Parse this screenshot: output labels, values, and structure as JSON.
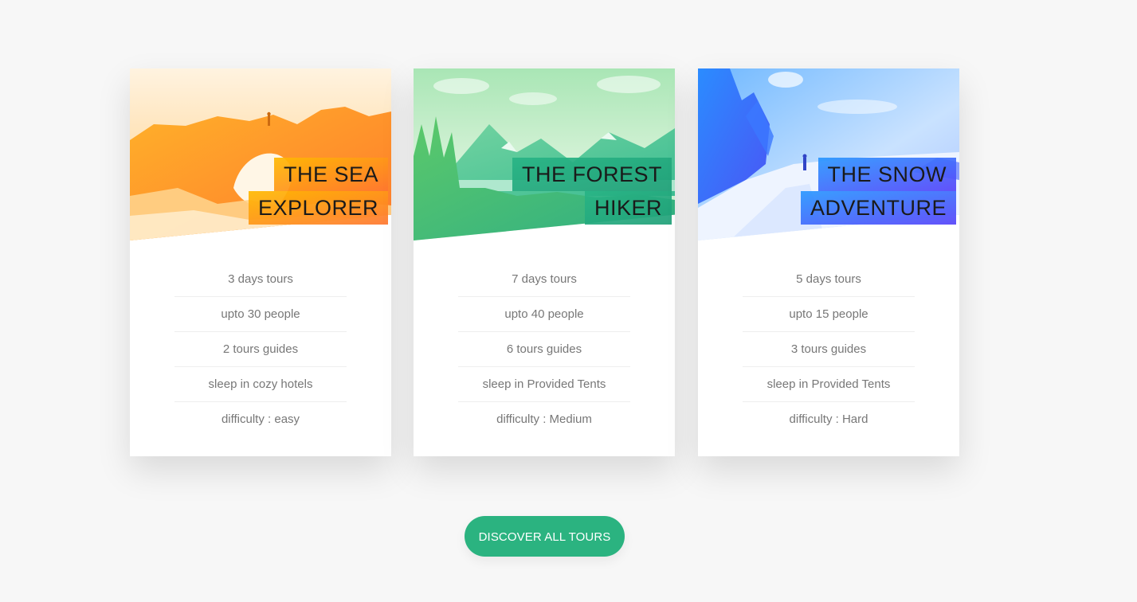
{
  "colors": {
    "page_background": "#f7f7f7",
    "button": "#2bb380",
    "card1_gradient": [
      "#ffb900",
      "#ff7730"
    ],
    "card2_gradient": [
      "#7ed56f",
      "#28b485"
    ],
    "card3_gradient": [
      "#2998ff",
      "#5643fa"
    ]
  },
  "cards": [
    {
      "heading_line1": "THE SEA",
      "heading_line2": "EXPLORER",
      "details": [
        "3 days tours",
        "upto 30 people",
        "2 tours guides",
        "sleep in cozy hotels",
        "difficulty : easy"
      ]
    },
    {
      "heading_line1": "THE FOREST",
      "heading_line2": "HIKER",
      "details": [
        "7 days tours",
        "upto 40 people",
        "6 tours guides",
        "sleep in Provided Tents",
        "difficulty : Medium"
      ]
    },
    {
      "heading_line1": "THE SNOW",
      "heading_line2": "ADVENTURE",
      "details": [
        "5 days tours",
        "upto 15 people",
        "3 tours guides",
        "sleep in Provided Tents",
        "difficulty : Hard"
      ]
    }
  ],
  "cta": {
    "label": "DISCOVER ALL TOURS"
  }
}
